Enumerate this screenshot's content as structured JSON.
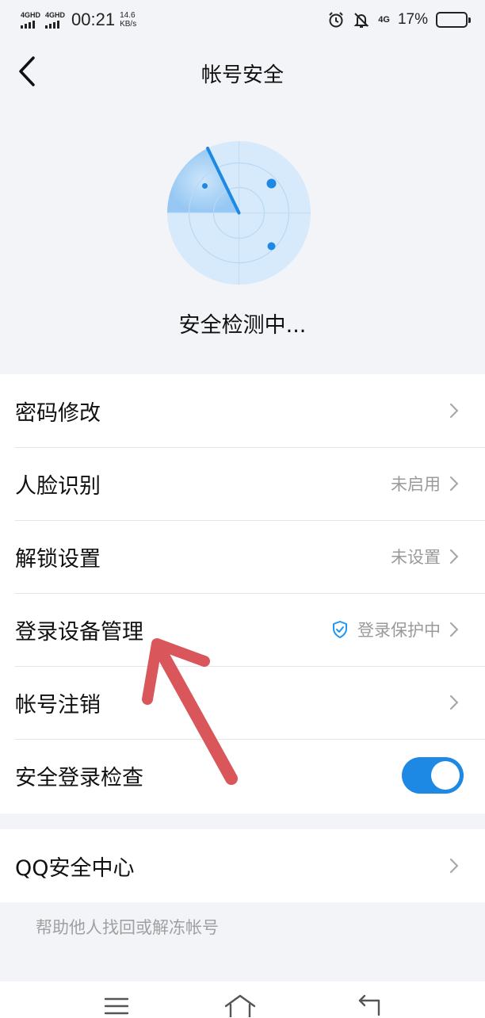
{
  "status_bar": {
    "sim1": "4GHD",
    "sim2": "4GHD",
    "time": "00:21",
    "speed_value": "14.6",
    "speed_unit": "KB/s",
    "alarm_icon": "alarm-clock-icon",
    "mute_icon": "bell-off-icon",
    "network": "4G",
    "battery_percent": "17%",
    "battery_level": 0.17
  },
  "header": {
    "back_icon": "chevron-left-icon",
    "title": "帐号安全"
  },
  "scan": {
    "radar_icon": "radar-icon",
    "status_text": "安全检测中..."
  },
  "settings": [
    {
      "label": "密码修改",
      "value": ""
    },
    {
      "label": "人脸识别",
      "value": "未启用"
    },
    {
      "label": "解锁设置",
      "value": "未设置"
    },
    {
      "label": "登录设备管理",
      "value": "登录保护中",
      "icon": "shield-check-icon"
    },
    {
      "label": "帐号注销",
      "value": ""
    },
    {
      "label": "安全登录检查",
      "toggle_on": true
    }
  ],
  "security_center": {
    "label": "QQ安全中心",
    "helper_link": "帮助他人找回或解冻帐号"
  },
  "bottom_nav": {
    "menu_icon": "menu-icon",
    "home_icon": "home-icon",
    "back_icon": "return-icon"
  },
  "colors": {
    "accent": "#1e88e5",
    "annotation_arrow": "#d9575b",
    "background": "#f3f4f8"
  }
}
